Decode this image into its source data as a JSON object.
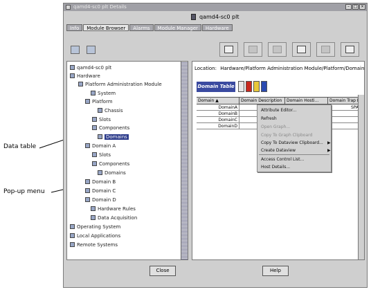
{
  "window": {
    "title": "qamd4-sc0 plt Details",
    "subtitle": "qamd4-sc0 plt",
    "controls": [
      "–",
      "□",
      "×"
    ]
  },
  "tabs": [
    {
      "label": "Info",
      "active": false
    },
    {
      "label": "Module Browser",
      "active": true
    },
    {
      "label": "Alarms",
      "active": false
    },
    {
      "label": "Module Manager",
      "active": false
    },
    {
      "label": "Hardware",
      "active": false
    }
  ],
  "tree": {
    "items": [
      {
        "label": "qamd4-sc0 plt"
      },
      {
        "label": "Hardware"
      },
      {
        "label": "Platform Administration Module"
      },
      {
        "label": "System"
      },
      {
        "label": "Platform"
      },
      {
        "label": "Chassis"
      },
      {
        "label": "Slots"
      },
      {
        "label": "Components"
      },
      {
        "label": "Domains"
      },
      {
        "label": "Domain A"
      },
      {
        "label": "Slots"
      },
      {
        "label": "Components"
      },
      {
        "label": "Domains"
      },
      {
        "label": "Domain B"
      },
      {
        "label": "Domain C"
      },
      {
        "label": "Domain D"
      },
      {
        "label": "Hardware Rules"
      },
      {
        "label": "Data Acquisition"
      },
      {
        "label": "Operating System"
      },
      {
        "label": "Local Applications"
      },
      {
        "label": "Remote Systems"
      }
    ]
  },
  "location": {
    "label": "Location:",
    "path": "Hardware/Platform Administration Module/Platform/Domains"
  },
  "data_table": {
    "title": "Domain Table",
    "columns": [
      "Domain ▲",
      "Domain Description",
      "Domain Hosti...",
      "Domain Trap Hosts"
    ],
    "rows": [
      [
        "DomainA",
        "",
        "",
        "SPACE"
      ],
      [
        "DomainB",
        "",
        "",
        ""
      ],
      [
        "DomainC",
        "",
        "",
        ""
      ],
      [
        "DomainD",
        "",
        "",
        ""
      ]
    ]
  },
  "context_menu": {
    "items": [
      {
        "label": "Attribute Editor...",
        "enabled": true,
        "submenu": false
      },
      {
        "label": "Refresh",
        "enabled": true,
        "submenu": false
      },
      {
        "label": "Open Graph...",
        "enabled": false,
        "submenu": false
      },
      {
        "label": "Copy To Graph Clipboard",
        "enabled": false,
        "submenu": false
      },
      {
        "label": "Copy To Dataview Clipboard...",
        "enabled": true,
        "submenu": true
      },
      {
        "label": "Create Dataview",
        "enabled": true,
        "submenu": true
      },
      {
        "label": "Access Control List...",
        "enabled": true,
        "submenu": false
      },
      {
        "label": "Host Details...",
        "enabled": true,
        "submenu": false
      }
    ]
  },
  "buttons": {
    "close": "Close",
    "help": "Help"
  },
  "annotations": {
    "data_table": "Data table",
    "popup_menu": "Pop-up menu"
  },
  "colors": {
    "selection": "#2b3a8a",
    "table_label": "#3a4aa0",
    "titlebar": "#a0a0a6"
  }
}
